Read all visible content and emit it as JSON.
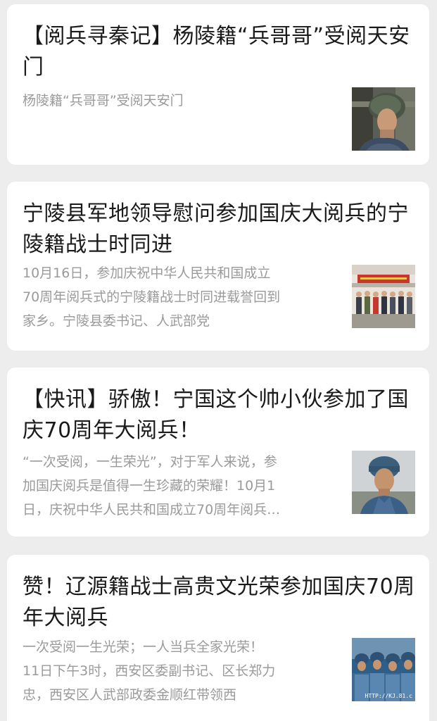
{
  "articles": [
    {
      "title": "【阅兵寻秦记】杨陵籍“兵哥哥”受阅天安门",
      "summary_lines": [
        "杨陵籍“兵哥哥”受阅天安门"
      ],
      "thumbnail": "soldier-helmet-thumbnail"
    },
    {
      "title": "宁陵县军地领导慰问参加国庆大阅兵的宁陵籍战士时同进",
      "summary_lines": [
        "10月16日，参加庆祝中华人民共和国成立",
        "70周年阅兵式的宁陵籍战士时同进载誉回到",
        "家乡。宁陵县委书记、人武部党"
      ],
      "thumbnail": "group-photo-thumbnail"
    },
    {
      "title": "【快讯】骄傲！宁国这个帅小伙参加了国庆70周年大阅兵！",
      "summary_lines": [
        "“一次受阅，一生荣光”，对于军人来说，参",
        "加国庆阅兵是值得一生珍藏的荣耀！10月1",
        "日，庆祝中华人民共和国成立70周年阅兵…"
      ],
      "thumbnail": "soldier-portrait-thumbnail"
    },
    {
      "title": "赞！辽源籍战士高贵文光荣参加国庆70周年大阅兵",
      "summary_lines": [
        "一次受阅一生光荣；一人当兵全家光荣！",
        "11日下午3时，西安区委副书记、区长郑力",
        "忠，西安区人武部政委金顺红带领西"
      ],
      "thumbnail": "soldiers-formation-thumbnail",
      "thumbnail_watermark": "HTTP://KJ.81.c"
    }
  ]
}
